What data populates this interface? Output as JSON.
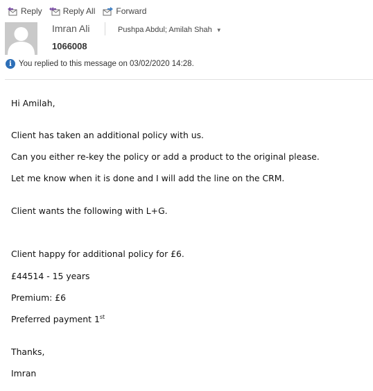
{
  "toolbar": {
    "reply": "Reply",
    "reply_all": "Reply All",
    "forward": "Forward"
  },
  "header": {
    "sender": "Imran Ali",
    "recipients": "Pushpa Abdul; Amilah Shah",
    "subject": "1066008",
    "info": "You replied to this message on 03/02/2020 14:28."
  },
  "body": {
    "greeting": "Hi Amilah,",
    "p1": "Client has taken an additional policy with us.",
    "p2": "Can you either re-key the policy or add a product to the original please.",
    "p3": "Let me know when it is done and I will add the line on the CRM.",
    "p4": "Client wants the following with L+G.",
    "p5": "Client happy for additional policy for £6.",
    "p6": "£44514 - 15 years",
    "p7": "Premium: £6",
    "p8": "Preferred payment 1",
    "p8_sup": "st",
    "signoff": "Thanks,",
    "signature": "Imran"
  }
}
